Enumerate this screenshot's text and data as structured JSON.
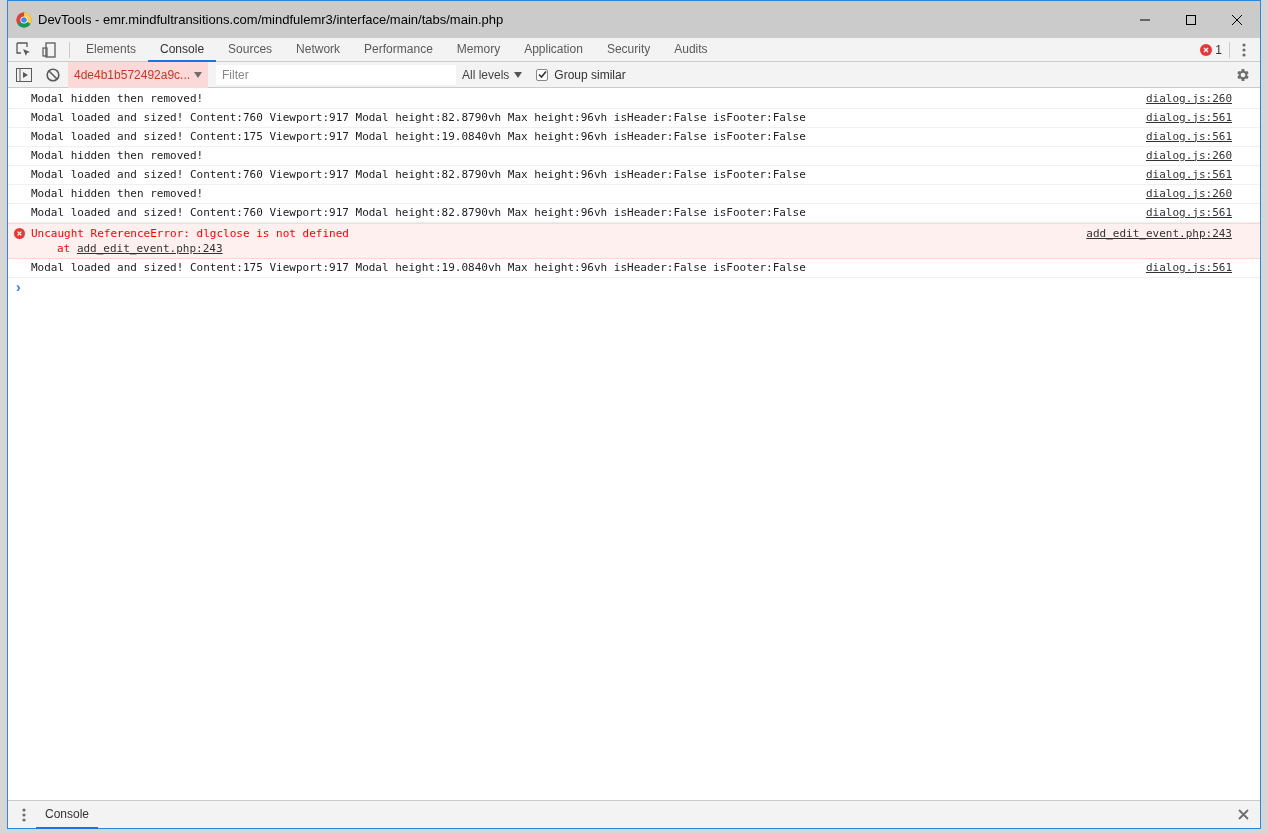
{
  "window": {
    "title": "DevTools - emr.mindfultransitions.com/mindfulemr3/interface/main/tabs/main.php"
  },
  "tabs": [
    {
      "label": "Elements",
      "selected": false
    },
    {
      "label": "Console",
      "selected": true
    },
    {
      "label": "Sources",
      "selected": false
    },
    {
      "label": "Network",
      "selected": false
    },
    {
      "label": "Performance",
      "selected": false
    },
    {
      "label": "Memory",
      "selected": false
    },
    {
      "label": "Application",
      "selected": false
    },
    {
      "label": "Security",
      "selected": false
    },
    {
      "label": "Audits",
      "selected": false
    }
  ],
  "error_count": "1",
  "toolbar": {
    "context": "4de4b1b572492a9c...",
    "filter": {
      "placeholder": "Filter"
    },
    "levels": "All levels",
    "group_similar": {
      "label": "Group similar",
      "checked": true
    }
  },
  "messages": [
    {
      "kind": "log",
      "text": "Modal hidden then removed!",
      "source": "dialog.js:260"
    },
    {
      "kind": "log",
      "text": "Modal loaded and sized! Content:760 Viewport:917 Modal height:82.8790vh Max height:96vh isHeader:False isFooter:False",
      "source": "dialog.js:561"
    },
    {
      "kind": "log",
      "text": "Modal loaded and sized! Content:175 Viewport:917 Modal height:19.0840vh Max height:96vh isHeader:False isFooter:False",
      "source": "dialog.js:561"
    },
    {
      "kind": "log",
      "text": "Modal hidden then removed!",
      "source": "dialog.js:260"
    },
    {
      "kind": "log",
      "text": "Modal loaded and sized! Content:760 Viewport:917 Modal height:82.8790vh Max height:96vh isHeader:False isFooter:False",
      "source": "dialog.js:561"
    },
    {
      "kind": "log",
      "text": "Modal hidden then removed!",
      "source": "dialog.js:260"
    },
    {
      "kind": "log",
      "text": "Modal loaded and sized! Content:760 Viewport:917 Modal height:82.8790vh Max height:96vh isHeader:False isFooter:False",
      "source": "dialog.js:561"
    },
    {
      "kind": "error",
      "text": "Uncaught ReferenceError: dlgclose is not defined",
      "stack_prefix": "at",
      "stack_link": "add_edit_event.php:243",
      "source": "add_edit_event.php:243"
    },
    {
      "kind": "log",
      "text": "Modal loaded and sized! Content:175 Viewport:917 Modal height:19.0840vh Max height:96vh isHeader:False isFooter:False",
      "source": "dialog.js:561"
    }
  ],
  "prompt": "›",
  "drawer": {
    "tabs": [
      {
        "label": "Console",
        "selected": true
      }
    ]
  }
}
